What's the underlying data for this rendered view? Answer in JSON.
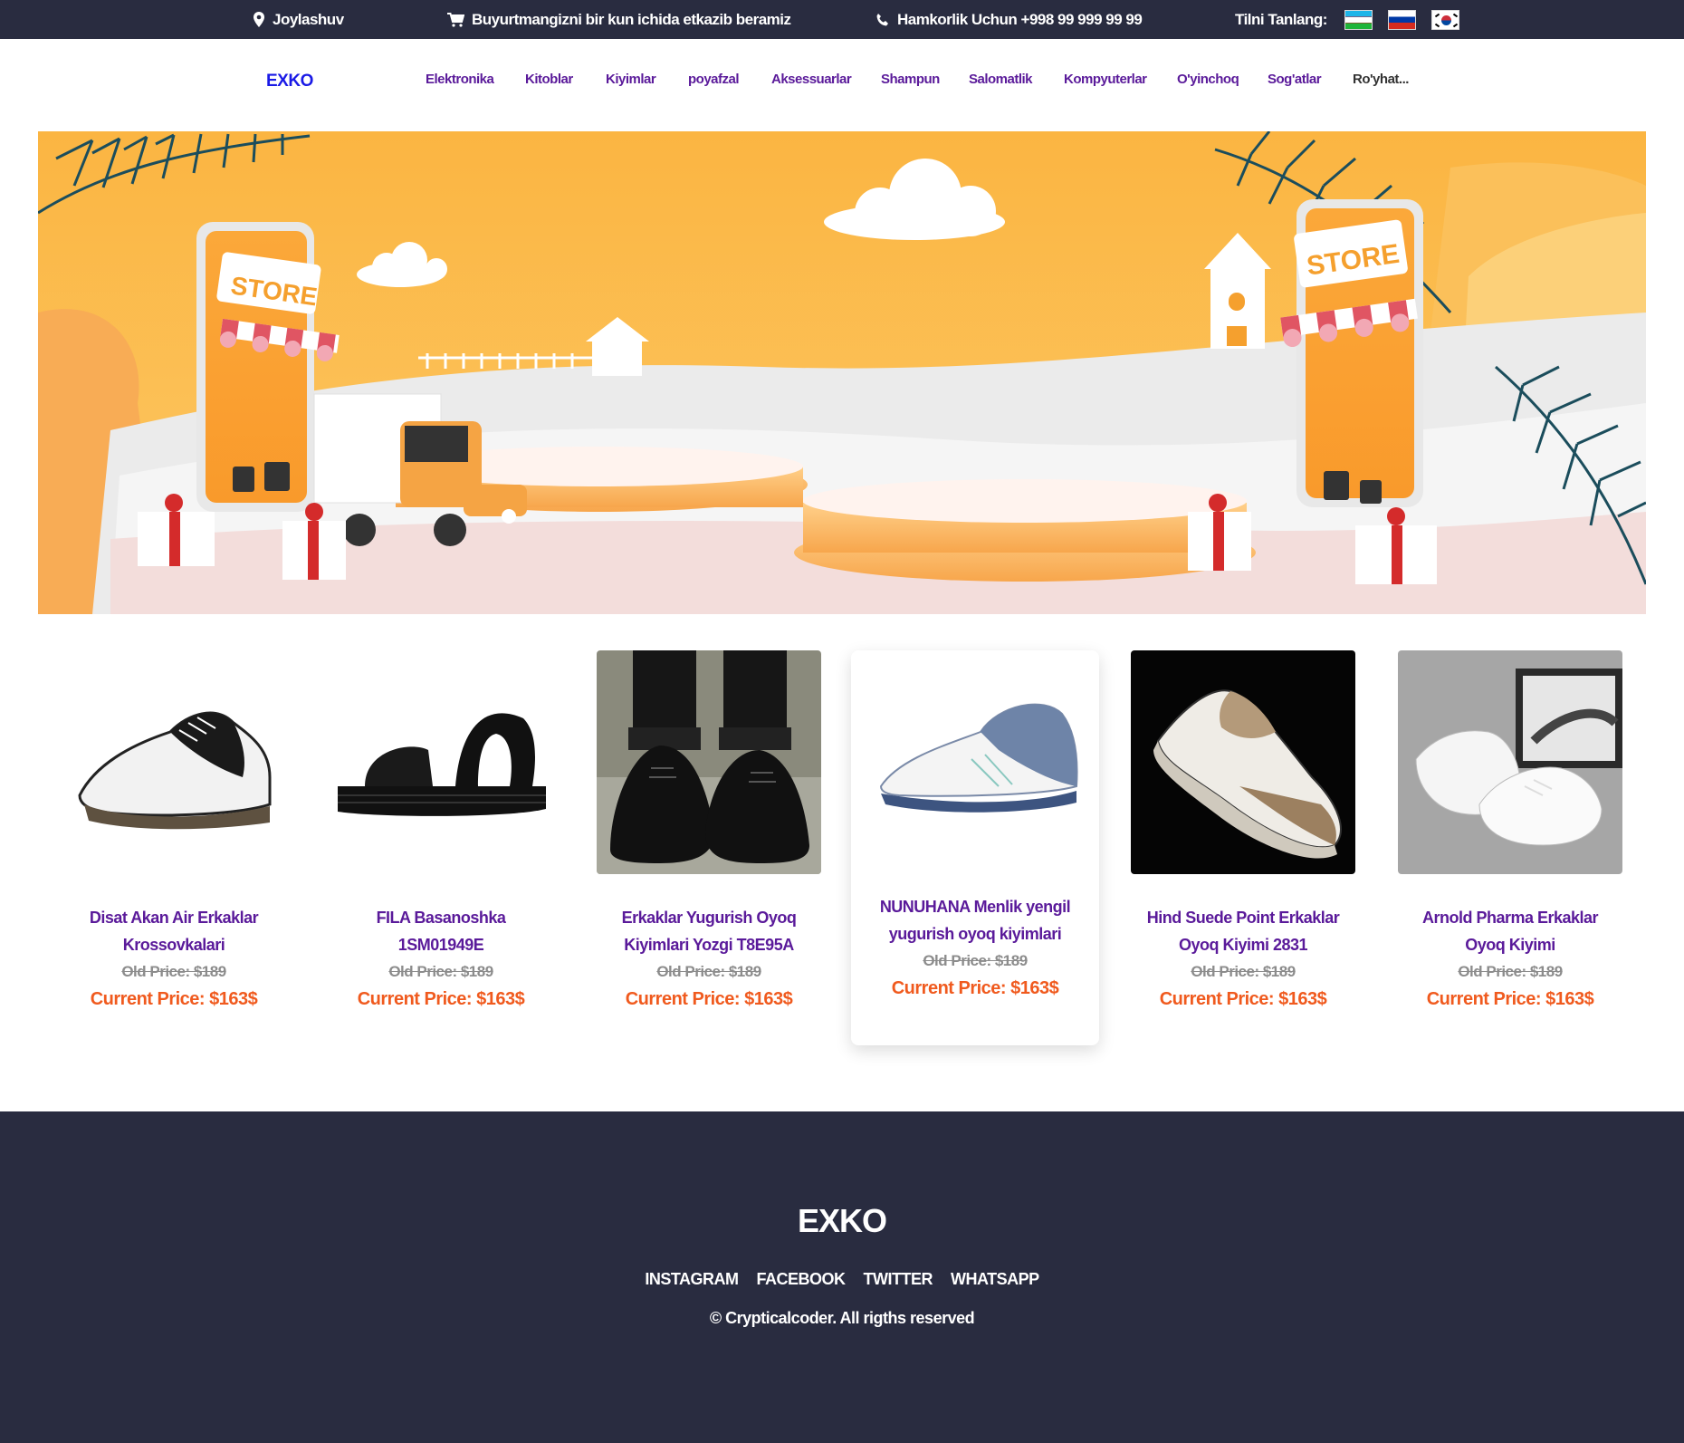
{
  "topbar": {
    "location": "Joylashuv",
    "delivery": "Buyurtmangizni bir kun ichida etkazib beramiz",
    "partnership": "Hamkorlik Uchun +998 99 999 99 99",
    "language_label": "Tilni Tanlang:",
    "languages": [
      "uz-flag-icon",
      "ru-flag-icon",
      "kr-flag-icon"
    ]
  },
  "nav": {
    "logo": "EXKO",
    "items": [
      {
        "label": "Elektronika"
      },
      {
        "label": "Kitoblar"
      },
      {
        "label": "Kiyimlar"
      },
      {
        "label": "poyafzal"
      },
      {
        "label": "Aksessuarlar"
      },
      {
        "label": "Shampun"
      },
      {
        "label": "Salomatlik"
      },
      {
        "label": "Kompyuterlar"
      },
      {
        "label": "O'yinchoq"
      },
      {
        "label": "Sog'atlar"
      },
      {
        "label": "Ro'yhat..."
      }
    ]
  },
  "hero": {
    "store_sign_left": "STORE",
    "store_sign_right": "STORE"
  },
  "products": [
    {
      "name": "Disat Akan Air Erkaklar Krossovkalari",
      "old_price": "Old Price: $189",
      "current_price": "Current Price: $163$",
      "image": "sneaker-white-black"
    },
    {
      "name": "FILA Basanoshka 1SM01949E",
      "old_price": "Old Price: $189",
      "current_price": "Current Price: $163$",
      "image": "sandal-black"
    },
    {
      "name": "Erkaklar Yugurish Oyoq Kiyimlari Yozgi T8E95A",
      "old_price": "Old Price: $189",
      "current_price": "Current Price: $163$",
      "image": "sneaker-black-worn"
    },
    {
      "name": "NUNUHANA Menlik yengil yugurish oyoq kiyimlari",
      "old_price": "Old Price: $189",
      "current_price": "Current Price: $163$",
      "image": "sneaker-white-blue"
    },
    {
      "name": "Hind Suede Point Erkaklar Oyoq Kiyimi 2831",
      "old_price": "Old Price: $189",
      "current_price": "Current Price: $163$",
      "image": "sneaker-suede-dark-bg"
    },
    {
      "name": "Arnold Pharma Erkaklar Oyoq Kiyimi",
      "old_price": "Old Price: $189",
      "current_price": "Current Price: $163$",
      "image": "sneaker-white-grey-bg"
    }
  ],
  "footer": {
    "logo": "EXKO",
    "links": [
      "INSTAGRAM",
      "FACEBOOK",
      "TWITTER",
      "WHATSAPP"
    ],
    "copyright": "© Crypticalcoder. All rigths reserved"
  },
  "colors": {
    "dark_bg": "#292c40",
    "nav_text": "#5a1a9a",
    "logo": "#1a1ae6",
    "price_current": "#f05a1e",
    "price_old": "#8c8c8c",
    "hero_orange": "#fbb94a"
  }
}
